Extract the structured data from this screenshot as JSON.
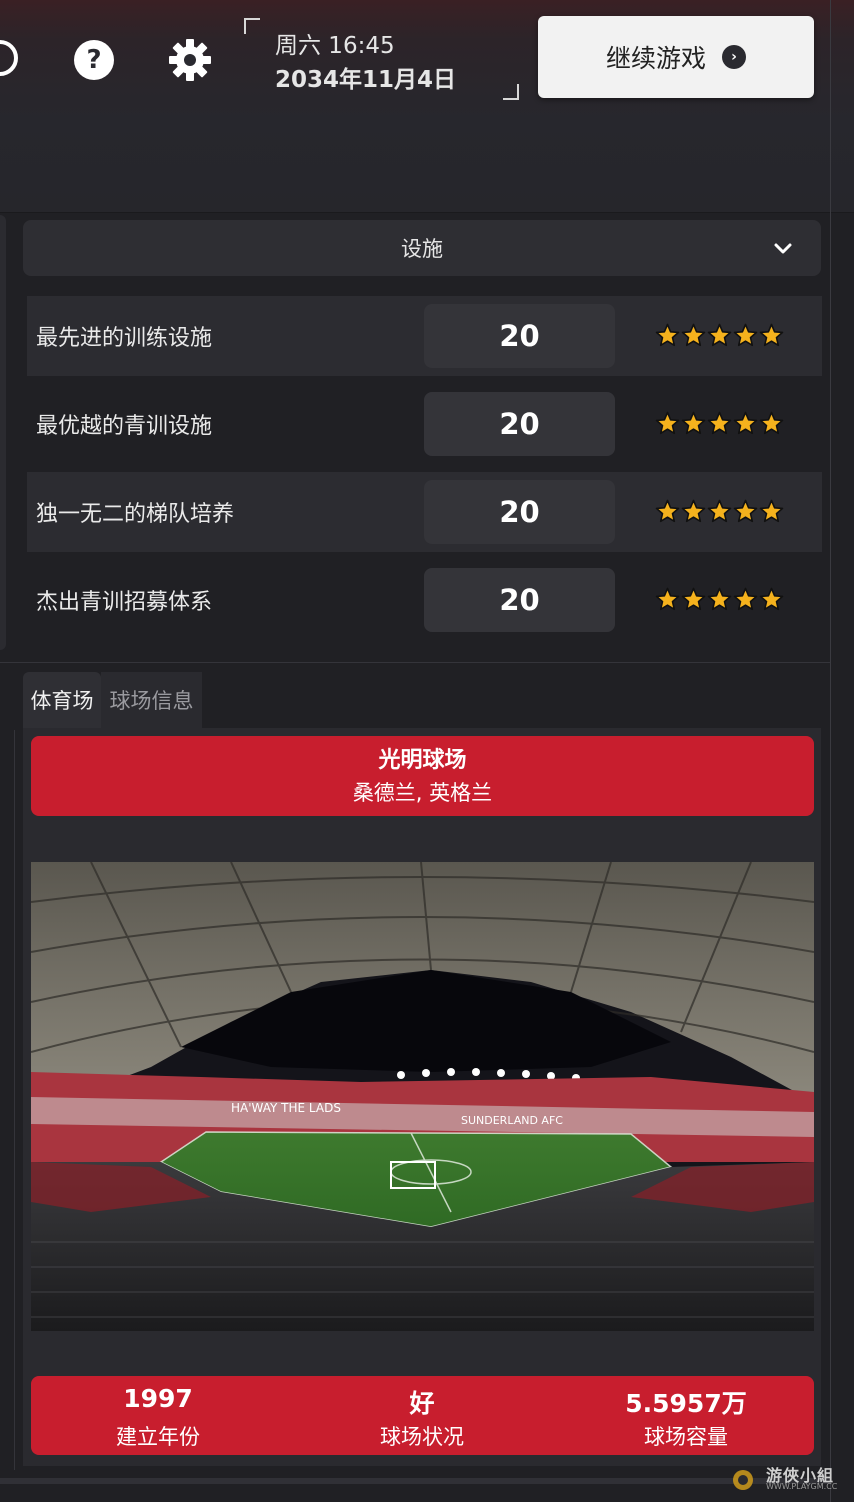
{
  "header": {
    "help_icon_text": "?",
    "datetime_line1": "周六 16:45",
    "datetime_line2": "2034年11月4日",
    "continue_label": "继续游戏"
  },
  "facilities": {
    "header_label": "设施",
    "rows": [
      {
        "label": "最先进的训练设施",
        "value": "20",
        "stars": 5
      },
      {
        "label": "最优越的青训设施",
        "value": "20",
        "stars": 5
      },
      {
        "label": "独一无二的梯队培养",
        "value": "20",
        "stars": 5
      },
      {
        "label": "杰出青训招募体系",
        "value": "20",
        "stars": 5
      }
    ]
  },
  "tabs": [
    {
      "label": "体育场",
      "active": true
    },
    {
      "label": "球场信息",
      "active": false
    }
  ],
  "stadium": {
    "name": "光明球场",
    "location": "桑德兰, 英格兰",
    "photo_banner_left": "HA'WAY THE LADS",
    "photo_banner_right": "SUNDERLAND AFC",
    "stats": [
      {
        "value": "1997",
        "label": "建立年份"
      },
      {
        "value": "好",
        "label": "球场状况"
      },
      {
        "value": "5.5957万",
        "label": "球场容量"
      }
    ]
  },
  "watermark": {
    "main": "游俠小組",
    "sub": "WWW.PLAYGM.CC"
  },
  "colors": {
    "accent_red": "#c81e2e",
    "star_gold": "#f5b21d",
    "panel_bg": "#2a2a2f"
  }
}
